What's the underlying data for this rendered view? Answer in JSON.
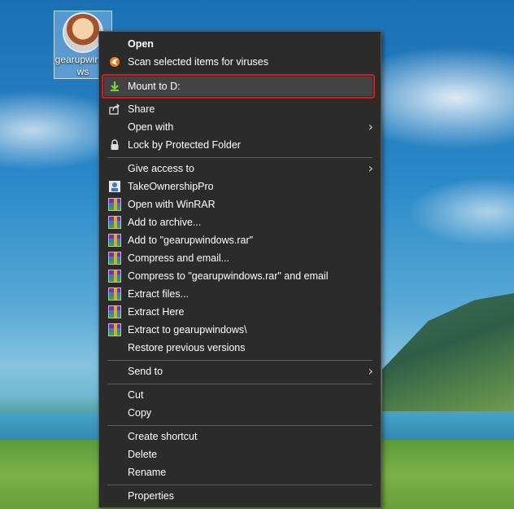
{
  "desktop": {
    "icon_label": "gearupwindows"
  },
  "menu": {
    "items": [
      {
        "key": "open",
        "label": "Open"
      },
      {
        "key": "scan",
        "label": "Scan selected items for viruses"
      },
      {
        "key": "mount",
        "label": "Mount to D:"
      },
      {
        "key": "share",
        "label": "Share"
      },
      {
        "key": "open_with",
        "label": "Open with"
      },
      {
        "key": "lock",
        "label": "Lock by Protected Folder"
      },
      {
        "key": "give_access",
        "label": "Give access to"
      },
      {
        "key": "take_ownership",
        "label": "TakeOwnershipPro"
      },
      {
        "key": "open_winrar",
        "label": "Open with WinRAR"
      },
      {
        "key": "add_archive",
        "label": "Add to archive..."
      },
      {
        "key": "add_rar",
        "label": "Add to \"gearupwindows.rar\""
      },
      {
        "key": "compress_email",
        "label": "Compress and email..."
      },
      {
        "key": "compress_rar_email",
        "label": "Compress to \"gearupwindows.rar\" and email"
      },
      {
        "key": "extract_files",
        "label": "Extract files..."
      },
      {
        "key": "extract_here",
        "label": "Extract Here"
      },
      {
        "key": "extract_to",
        "label": "Extract to gearupwindows\\"
      },
      {
        "key": "restore",
        "label": "Restore previous versions"
      },
      {
        "key": "send_to",
        "label": "Send to"
      },
      {
        "key": "cut",
        "label": "Cut"
      },
      {
        "key": "copy",
        "label": "Copy"
      },
      {
        "key": "create_shortcut",
        "label": "Create shortcut"
      },
      {
        "key": "delete",
        "label": "Delete"
      },
      {
        "key": "rename",
        "label": "Rename"
      },
      {
        "key": "properties",
        "label": "Properties"
      }
    ]
  },
  "colors": {
    "menu_bg": "#2b2b2b",
    "highlight_border": "#d11d1d",
    "hover_bg": "#434343"
  }
}
